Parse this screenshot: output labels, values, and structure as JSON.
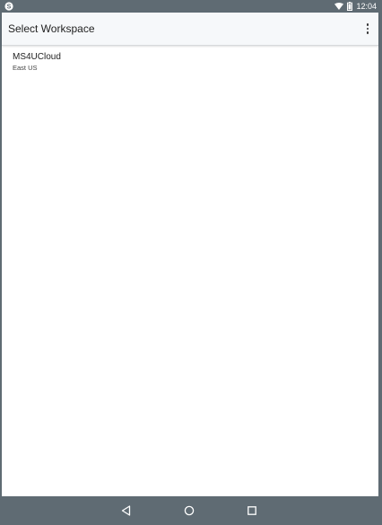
{
  "status_bar": {
    "time": "12:04",
    "app_icon": "skype-icon",
    "wifi_icon": "wifi-icon",
    "battery_icon": "battery-icon"
  },
  "app_bar": {
    "title": "Select Workspace",
    "menu_icon": "overflow-menu-icon"
  },
  "workspaces": [
    {
      "name": "MS4UCloud",
      "region": "East US"
    }
  ],
  "nav_bar": {
    "back_icon": "back-icon",
    "home_icon": "home-icon",
    "recents_icon": "recents-icon"
  },
  "colors": {
    "system_bars": "#5f6b73",
    "app_bar_bg": "#f6f8fa",
    "content_bg": "#ffffff"
  }
}
